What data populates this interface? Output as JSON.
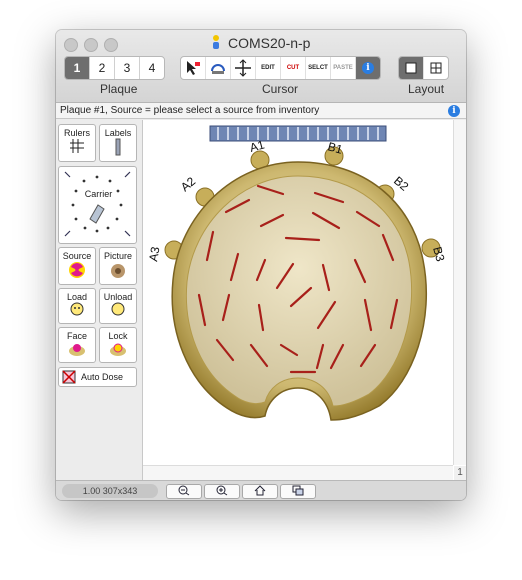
{
  "window": {
    "title": "COMS20-n-p"
  },
  "toolbar": {
    "plaque_tabs": [
      "1",
      "2",
      "3",
      "4"
    ],
    "plaque_selected": "1",
    "plaque_label": "Plaque",
    "cursor_tools": [
      {
        "name": "select-arrow",
        "label": ""
      },
      {
        "name": "rotate",
        "label": ""
      },
      {
        "name": "move",
        "label": ""
      },
      {
        "name": "edit",
        "label": "EDIT"
      },
      {
        "name": "cut",
        "label": "CUT"
      },
      {
        "name": "select",
        "label": "SELCT"
      },
      {
        "name": "paste",
        "label": "PASTE"
      },
      {
        "name": "info",
        "label": "i"
      }
    ],
    "cursor_label": "Cursor",
    "layout_label": "Layout"
  },
  "status": {
    "text": "Plaque #1, Source = please select a source from inventory"
  },
  "palette": {
    "rulers": "Rulers",
    "labels": "Labels",
    "carrier": "Carrier",
    "source": "Source",
    "picture": "Picture",
    "load": "Load",
    "unload": "Unload",
    "face": "Face",
    "lock": "Lock",
    "auto_dose": "Auto Dose"
  },
  "plaque": {
    "labels": [
      "A1",
      "B1",
      "A2",
      "B2",
      "A3",
      "B3"
    ]
  },
  "canvas": {
    "page_number": "1"
  },
  "footer": {
    "zoom": "1.00 307x343"
  }
}
